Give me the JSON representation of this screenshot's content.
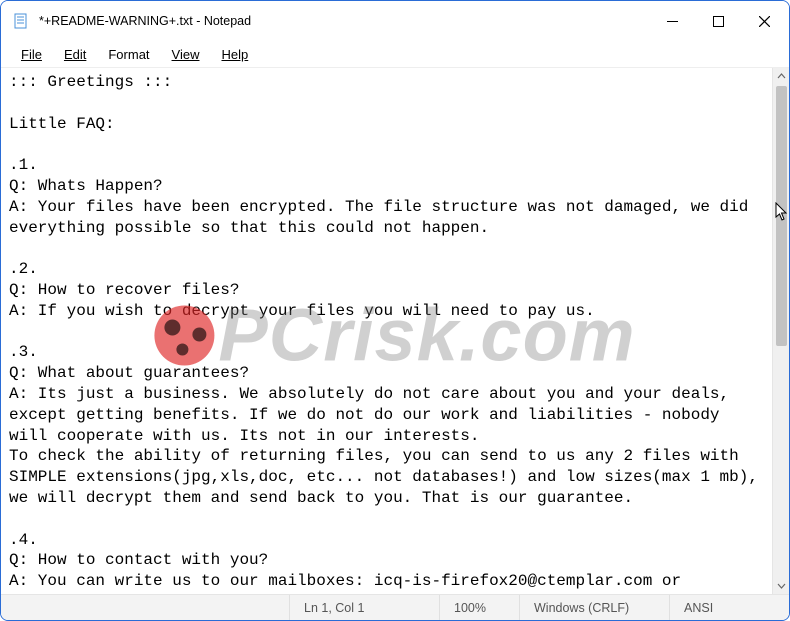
{
  "window": {
    "title": "*+README-WARNING+.txt - Notepad"
  },
  "menu": {
    "file": "File",
    "edit": "Edit",
    "format": "Format",
    "view": "View",
    "help": "Help"
  },
  "content": "::: Greetings :::\n\nLittle FAQ:\n\n.1.\nQ: Whats Happen?\nA: Your files have been encrypted. The file structure was not damaged, we did everything possible so that this could not happen.\n\n.2.\nQ: How to recover files?\nA: If you wish to decrypt your files you will need to pay us.\n\n.3.\nQ: What about guarantees?\nA: Its just a business. We absolutely do not care about you and your deals, except getting benefits. If we do not do our work and liabilities - nobody will cooperate with us. Its not in our interests.\nTo check the ability of returning files, you can send to us any 2 files with SIMPLE extensions(jpg,xls,doc, etc... not databases!) and low sizes(max 1 mb), we will decrypt them and send back to you. That is our guarantee.\n\n.4.\nQ: How to contact with you?\nA: You can write us to our mailboxes: icq-is-firefox20@ctemplar.com or",
  "status": {
    "position": "Ln 1, Col 1",
    "zoom": "100%",
    "line_ending": "Windows (CRLF)",
    "encoding": "ANSI"
  },
  "watermark": {
    "text": "PCrisk.com"
  }
}
